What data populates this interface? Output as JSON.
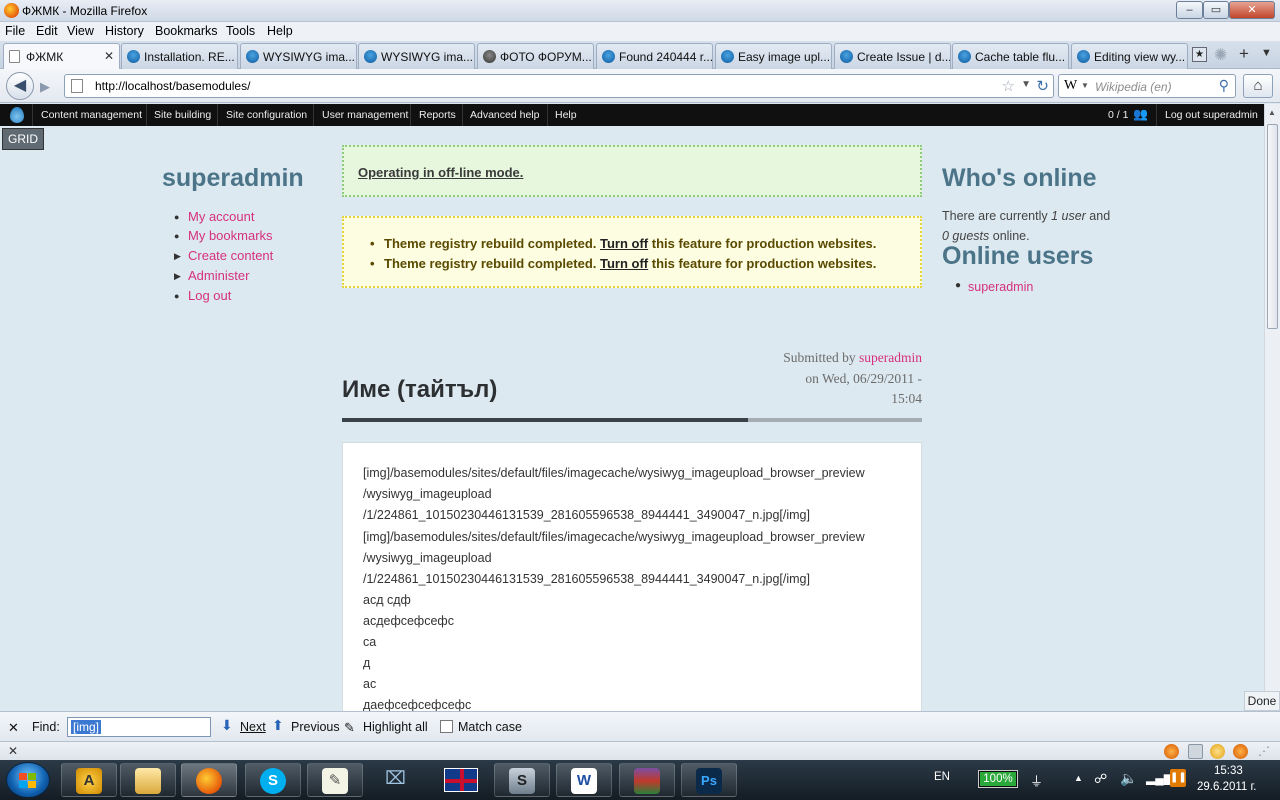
{
  "window": {
    "title": "ФЖМК - Mozilla Firefox",
    "min": "–",
    "max": "▭",
    "close": "✕"
  },
  "menubar": [
    "File",
    "Edit",
    "View",
    "History",
    "Bookmarks",
    "Tools",
    "Help"
  ],
  "tabs": [
    {
      "label": "ФЖМК",
      "icon": "page-icon",
      "active": true
    },
    {
      "label": "Installation. RE...",
      "icon": "drupal-icon"
    },
    {
      "label": "WYSIWYG ima...",
      "icon": "drupal-icon"
    },
    {
      "label": "WYSIWYG ima...",
      "icon": "drupal-icon"
    },
    {
      "label": "ФОТО ФОРУМ...",
      "icon": "forum-icon"
    },
    {
      "label": "Found 240444 r...",
      "icon": "drupal-icon"
    },
    {
      "label": "Easy image upl...",
      "icon": "drupal-icon"
    },
    {
      "label": "Create Issue | d...",
      "icon": "drupal-icon"
    },
    {
      "label": "Cache table flu...",
      "icon": "drupal-icon"
    },
    {
      "label": "Editing view wy...",
      "icon": "drupal-icon"
    }
  ],
  "tab_close": "✕",
  "nav": {
    "url": "http://localhost/basemodules/",
    "search_engine": "W",
    "search_placeholder": "Wikipedia (en)"
  },
  "admin_menu": {
    "items": [
      "Content management",
      "Site building",
      "Site configuration",
      "User management",
      "Reports",
      "Advanced help",
      "Help"
    ],
    "counter": "0 / 1",
    "logout": "Log out superadmin"
  },
  "grid_button": "GRID",
  "left_sidebar": {
    "title": "superadmin",
    "items": [
      {
        "label": "My account",
        "bullet": "●"
      },
      {
        "label": "My bookmarks",
        "bullet": "●"
      },
      {
        "label": "Create content",
        "bullet": "▶"
      },
      {
        "label": "Administer",
        "bullet": "▶"
      },
      {
        "label": "Log out",
        "bullet": "●"
      }
    ]
  },
  "messages": {
    "status": "Operating in off-line mode.",
    "warnings": [
      {
        "before": "Theme registry rebuild completed. ",
        "link": "Turn off",
        "after": " this feature for production websites."
      },
      {
        "before": "Theme registry rebuild completed. ",
        "link": "Turn off",
        "after": " this feature for production websites."
      }
    ]
  },
  "node": {
    "submitted_prefix": "Submitted by ",
    "author": "superadmin",
    "date_line1": "on Wed, 06/29/2011 -",
    "date_line2": "15:04",
    "title": "Име (тайтъл)",
    "body_lines": [
      "[img]/basemodules/sites/default/files/imagecache/wysiwyg_imageupload_browser_preview",
      "/wysiwyg_imageupload",
      "/1/224861_10150230446131539_281605596538_8944441_3490047_n.jpg[/img]",
      "[img]/basemodules/sites/default/files/imagecache/wysiwyg_imageupload_browser_preview",
      "/wysiwyg_imageupload",
      "/1/224861_10150230446131539_281605596538_8944441_3490047_n.jpg[/img]",
      "асд сдф",
      "асдефсефсефс",
      "са",
      "д",
      "ас",
      "даефсефсефсефс"
    ]
  },
  "right_sidebar": {
    "whos_online_title": "Who's online",
    "text_prefix": "There are currently ",
    "users": "1 user",
    "text_mid": " and ",
    "guests": "0 guests",
    "text_suffix": " online.",
    "online_users_title": "Online users",
    "online_users": [
      "superadmin"
    ]
  },
  "status_done": "Done",
  "findbar": {
    "close": "✕",
    "find_label": "Find:",
    "query": "[img]",
    "next": "Next",
    "previous": "Previous",
    "highlight_all": "Highlight all",
    "match_case": "Match case"
  },
  "statusbar_close": "✕",
  "taskbar": {
    "language": "EN",
    "battery": "100%",
    "battery_level": 1.0,
    "time": "15:33",
    "date": "29.6.2011 г."
  }
}
